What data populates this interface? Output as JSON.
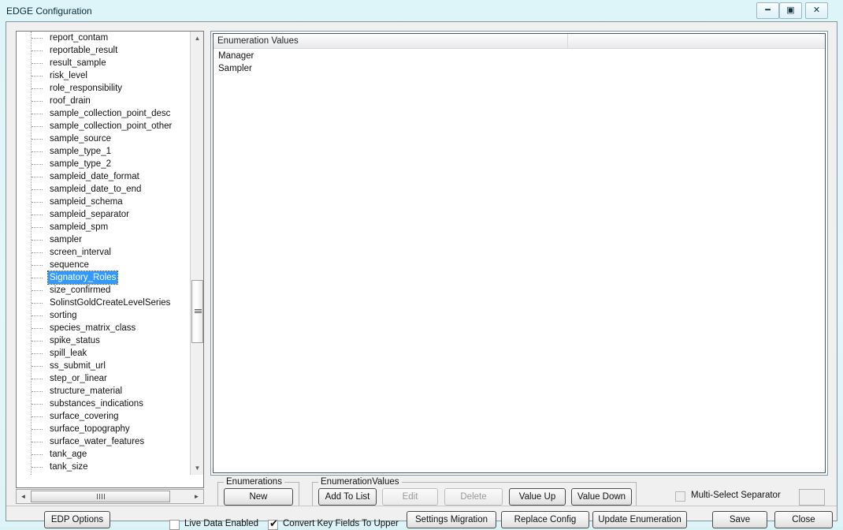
{
  "window": {
    "title": "EDGE Configuration",
    "controls": [
      {
        "name": "minimize-button",
        "glyph": "━"
      },
      {
        "name": "restore-button",
        "glyph": "▣"
      },
      {
        "name": "close-button",
        "glyph": "✕"
      }
    ]
  },
  "tree": {
    "selected": "Signatory_Roles",
    "items": [
      {
        "label": "report_contam",
        "selected": false
      },
      {
        "label": "reportable_result",
        "selected": false
      },
      {
        "label": "result_sample",
        "selected": false
      },
      {
        "label": "risk_level",
        "selected": false
      },
      {
        "label": "role_responsibility",
        "selected": false
      },
      {
        "label": "roof_drain",
        "selected": false
      },
      {
        "label": "sample_collection_point_desc",
        "selected": false
      },
      {
        "label": "sample_collection_point_other",
        "selected": false
      },
      {
        "label": "sample_source",
        "selected": false
      },
      {
        "label": "sample_type_1",
        "selected": false
      },
      {
        "label": "sample_type_2",
        "selected": false
      },
      {
        "label": "sampleid_date_format",
        "selected": false
      },
      {
        "label": "sampleid_date_to_end",
        "selected": false
      },
      {
        "label": "sampleid_schema",
        "selected": false
      },
      {
        "label": "sampleid_separator",
        "selected": false
      },
      {
        "label": "sampleid_spm",
        "selected": false
      },
      {
        "label": "sampler",
        "selected": false
      },
      {
        "label": "screen_interval",
        "selected": false
      },
      {
        "label": "sequence",
        "selected": false
      },
      {
        "label": "Signatory_Roles",
        "selected": true
      },
      {
        "label": "size_confirmed",
        "selected": false
      },
      {
        "label": "SolinstGoldCreateLevelSeries",
        "selected": false
      },
      {
        "label": "sorting",
        "selected": false
      },
      {
        "label": "species_matrix_class",
        "selected": false
      },
      {
        "label": "spike_status",
        "selected": false
      },
      {
        "label": "spill_leak",
        "selected": false
      },
      {
        "label": "ss_submit_url",
        "selected": false
      },
      {
        "label": "step_or_linear",
        "selected": false
      },
      {
        "label": "structure_material",
        "selected": false
      },
      {
        "label": "substances_indications",
        "selected": false
      },
      {
        "label": "surface_covering",
        "selected": false
      },
      {
        "label": "surface_topography",
        "selected": false
      },
      {
        "label": "surface_water_features",
        "selected": false
      },
      {
        "label": "tank_age",
        "selected": false
      },
      {
        "label": "tank_size",
        "selected": false
      }
    ],
    "scroll": {
      "up_glyph": "▲",
      "down_glyph": "▼",
      "left_glyph": "◄",
      "right_glyph": "►"
    }
  },
  "listview": {
    "columns": [
      "Enumeration Values",
      ""
    ],
    "rows": [
      "Manager",
      "Sampler"
    ]
  },
  "groups": {
    "enumerations": {
      "label": "Enumerations",
      "new_label": "New"
    },
    "enumeration_values": {
      "label": "EnumerationValues",
      "add_to_list_label": "Add To List",
      "edit_label": "Edit",
      "delete_label": "Delete",
      "value_up_label": "Value Up",
      "value_down_label": "Value Down"
    }
  },
  "multi_select": {
    "label": "Multi-Select Separator",
    "checked": false,
    "value": ""
  },
  "bottom": {
    "edp_options_label": "EDP Options",
    "live_data_label": "Live Data Enabled",
    "live_data_checked": false,
    "convert_label": "Convert Key Fields To Upper",
    "convert_checked": true,
    "convert_mark": "✔",
    "settings_migration_label": "Settings Migration",
    "replace_config_label": "Replace Config",
    "update_enumeration_label": "Update Enumeration",
    "save_label": "Save",
    "close_label": "Close"
  },
  "colors": {
    "titlebar": "#ddf5f9",
    "selection": "#3399ff",
    "client_bg": "#f0f0f0",
    "list_bg": "#ffffff"
  }
}
